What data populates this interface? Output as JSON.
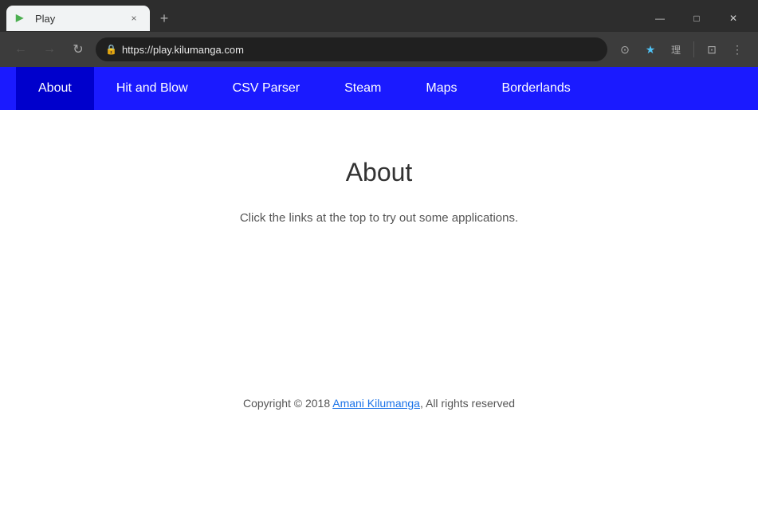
{
  "browser": {
    "tab": {
      "favicon": "▶",
      "title": "Play",
      "close_label": "×"
    },
    "new_tab_label": "+",
    "window_controls": {
      "minimize": "—",
      "maximize": "□",
      "close": "✕"
    },
    "nav": {
      "back_icon": "←",
      "forward_icon": "→",
      "reload_icon": "↻",
      "lock_icon": "🔒",
      "url": "https://play.kilumanga.com",
      "actions": {
        "circle_icon": "⊙",
        "star_icon": "★",
        "translate_icon": "理",
        "extension_icon": "⊡",
        "menu_icon": "⋮"
      }
    }
  },
  "navbar": {
    "items": [
      {
        "label": "About",
        "active": true
      },
      {
        "label": "Hit and Blow",
        "active": false
      },
      {
        "label": "CSV Parser",
        "active": false
      },
      {
        "label": "Steam",
        "active": false
      },
      {
        "label": "Maps",
        "active": false
      },
      {
        "label": "Borderlands",
        "active": false
      }
    ]
  },
  "page": {
    "heading": "About",
    "description": "Click the links at the top to try out some applications.",
    "footer": {
      "prefix": "Copyright © 2018 ",
      "link_text": "Amani Kilumanga",
      "suffix": ", All rights reserved"
    }
  }
}
